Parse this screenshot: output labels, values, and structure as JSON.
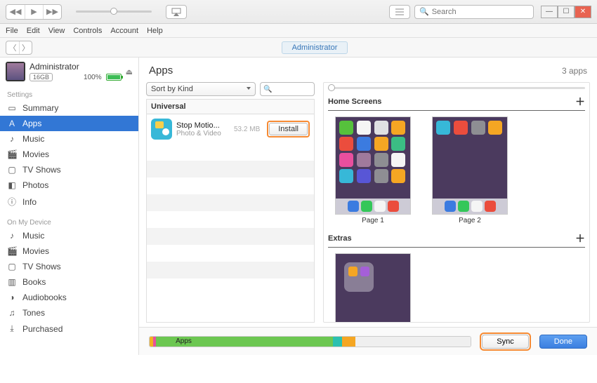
{
  "search_placeholder": "Search",
  "menu": {
    "file": "File",
    "edit": "Edit",
    "view": "View",
    "controls": "Controls",
    "account": "Account",
    "help": "Help"
  },
  "breadcrumb": "Administrator",
  "device": {
    "name": "Administrator",
    "capacity": "16GB",
    "battery_pct": "100%"
  },
  "settings_label": "Settings",
  "settings_items": [
    "Summary",
    "Apps",
    "Music",
    "Movies",
    "TV Shows",
    "Photos",
    "Info"
  ],
  "ondevice_label": "On My Device",
  "ondevice_items": [
    "Music",
    "Movies",
    "TV Shows",
    "Books",
    "Audiobooks",
    "Tones",
    "Purchased"
  ],
  "main": {
    "title": "Apps",
    "count": "3 apps",
    "sort": "Sort by Kind",
    "group": "Universal",
    "app": {
      "name": "Stop Motio...",
      "category": "Photo & Video",
      "size": "53.2 MB",
      "action": "Install"
    },
    "home_screens": "Home Screens",
    "page1": "Page 1",
    "page2": "Page 2",
    "extras": "Extras"
  },
  "footer": {
    "storage_label": "Apps",
    "sync": "Sync",
    "done": "Done"
  }
}
